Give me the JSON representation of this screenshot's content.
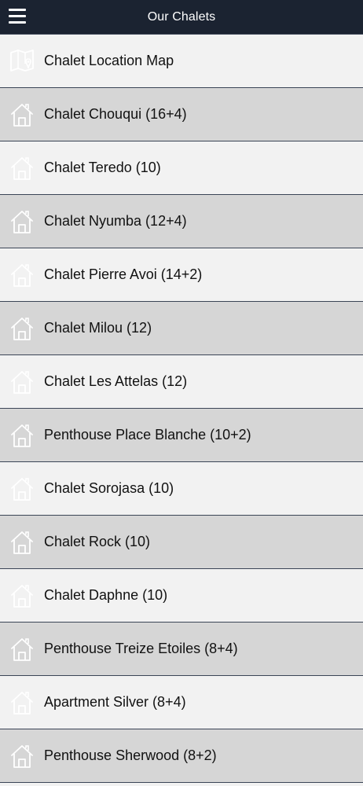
{
  "header": {
    "title": "Our Chalets",
    "menu_icon": "hamburger-menu-icon"
  },
  "items": [
    {
      "label": "Chalet Location Map",
      "icon": "map-pin-icon"
    },
    {
      "label": "Chalet Chouqui (16+4)",
      "icon": "house-icon"
    },
    {
      "label": "Chalet Teredo (10)",
      "icon": "house-icon"
    },
    {
      "label": "Chalet Nyumba (12+4)",
      "icon": "house-icon"
    },
    {
      "label": "Chalet Pierre Avoi (14+2)",
      "icon": "house-icon"
    },
    {
      "label": "Chalet Milou (12)",
      "icon": "house-icon"
    },
    {
      "label": "Chalet Les Attelas (12)",
      "icon": "house-icon"
    },
    {
      "label": "Penthouse Place Blanche (10+2)",
      "icon": "house-icon"
    },
    {
      "label": "Chalet Sorojasa (10)",
      "icon": "house-icon"
    },
    {
      "label": "Chalet Rock (10)",
      "icon": "house-icon"
    },
    {
      "label": "Chalet Daphne (10)",
      "icon": "house-icon"
    },
    {
      "label": "Penthouse Treize Etoiles (8+4)",
      "icon": "house-icon"
    },
    {
      "label": "Apartment Silver (8+4)",
      "icon": "house-icon"
    },
    {
      "label": "Penthouse Sherwood (8+2)",
      "icon": "house-icon"
    }
  ],
  "colors": {
    "header_bg": "#1b2331",
    "row_light": "#f2f2f2",
    "row_dark": "#d6d6d6",
    "divider": "#3b4556",
    "text": "#111111"
  }
}
